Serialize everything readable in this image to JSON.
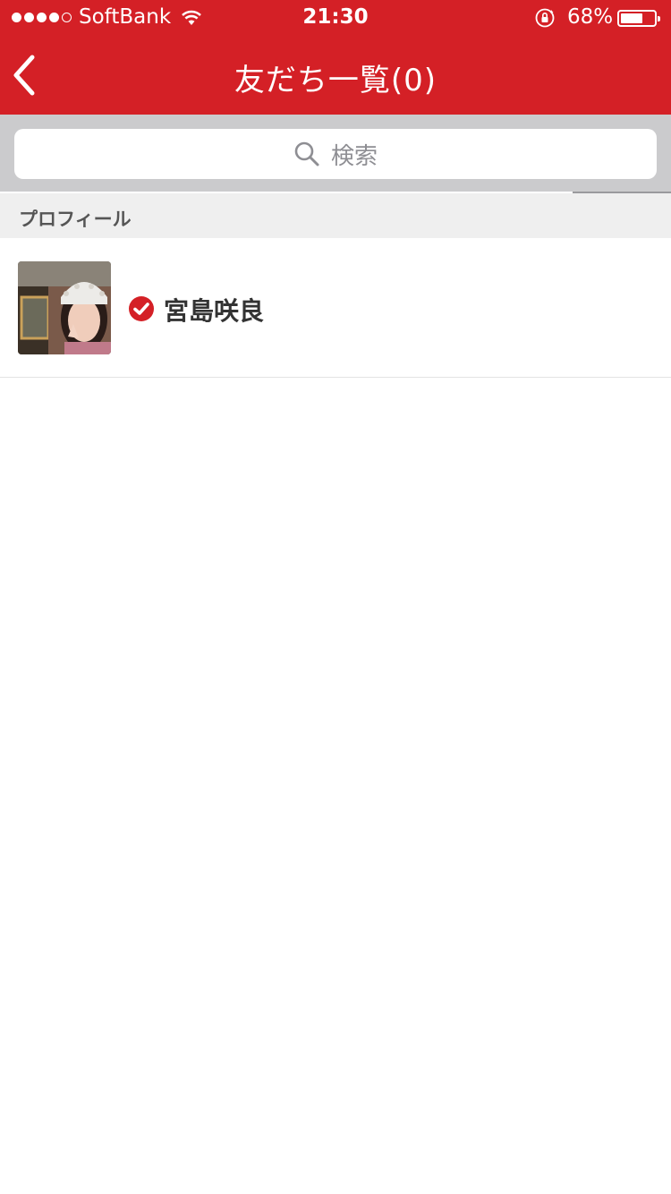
{
  "status_bar": {
    "carrier": "SoftBank",
    "time": "21:30",
    "battery_percent": "68%",
    "battery_level": 0.68,
    "signal_bars": 4,
    "signal_total": 5
  },
  "nav": {
    "title": "友だち一覧(0)",
    "back_icon": "chevron-left-icon"
  },
  "search": {
    "placeholder": "検索",
    "icon": "search-icon"
  },
  "section": {
    "label": "プロフィール"
  },
  "profile": {
    "name": "宮島咲良",
    "verified": true,
    "avatar_icon": "profile-photo"
  },
  "colors": {
    "brand_red": "#d42026",
    "search_bg": "#cbcbcd",
    "section_bg": "#efefef",
    "text_dark": "#333333"
  }
}
